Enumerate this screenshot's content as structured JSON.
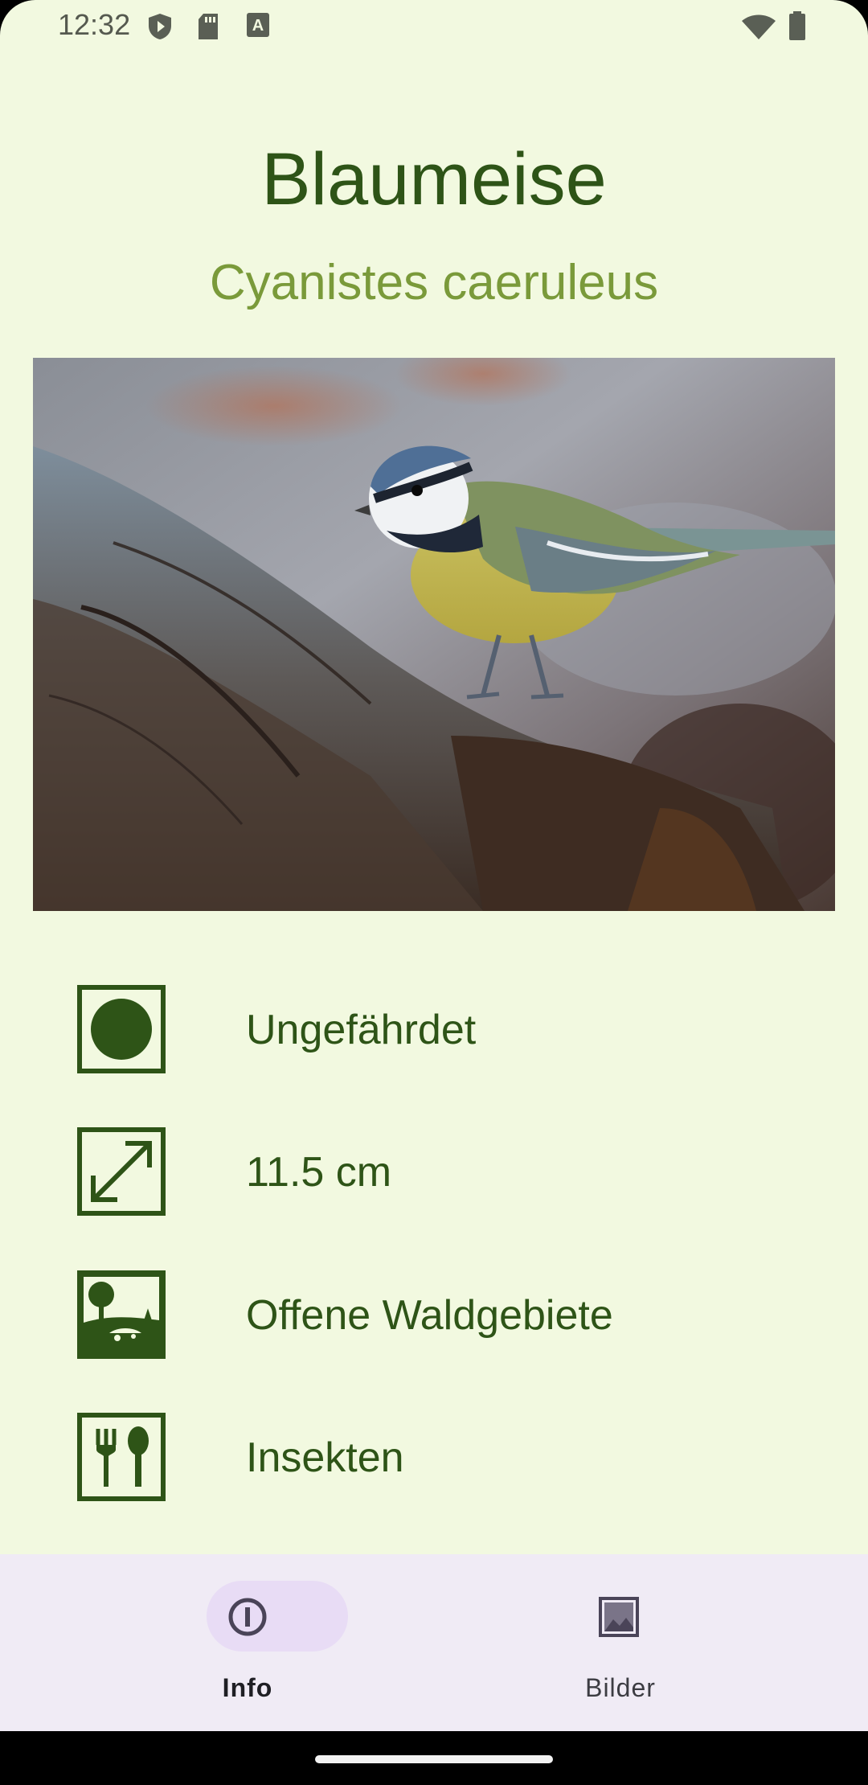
{
  "status_bar": {
    "time": "12:32",
    "left_icons": [
      "shield-play-icon",
      "sd-card-icon",
      "font-download-icon"
    ],
    "right_icons": [
      "wifi-icon",
      "battery-icon"
    ]
  },
  "header": {
    "title": "Blaumeise",
    "subtitle": "Cyanistes caeruleus"
  },
  "photo": {
    "subject": "blue-tit-on-log-photo"
  },
  "info": {
    "items": [
      {
        "icon": "status-circle-icon",
        "label": "Ungefährdet"
      },
      {
        "icon": "size-arrows-icon",
        "label": "11.5 cm"
      },
      {
        "icon": "habitat-landscape-icon",
        "label": "Offene Waldgebiete"
      },
      {
        "icon": "food-cutlery-icon",
        "label": "Insekten"
      }
    ]
  },
  "bottom_nav": {
    "tabs": [
      {
        "label": "Info",
        "icon": "info-icon",
        "active": true
      },
      {
        "label": "Bilder",
        "icon": "image-icon",
        "active": false
      }
    ]
  },
  "colors": {
    "background": "#f2f9e0",
    "title": "#2e5417",
    "subtitle": "#7a9a3a",
    "icon": "#2e5417",
    "nav_background": "#f0ebf5",
    "nav_active_pill": "#e8dcf5"
  }
}
